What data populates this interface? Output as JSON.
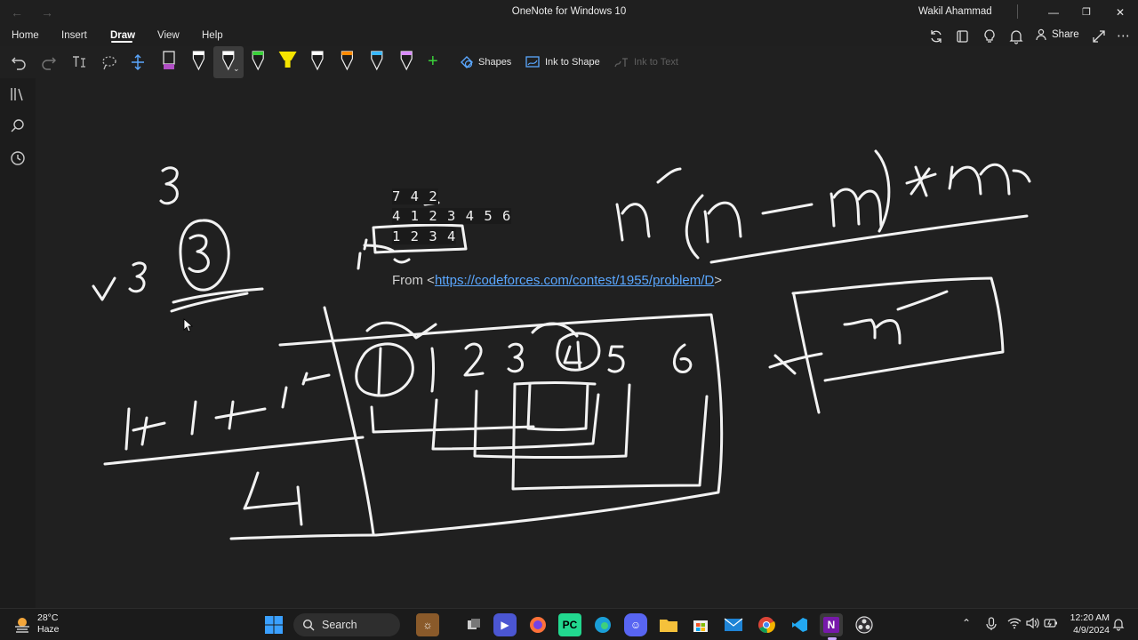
{
  "window": {
    "title": "OneNote for Windows 10",
    "user": "Wakil Ahammad",
    "back_glyph": "←",
    "forward_glyph": "→",
    "minimize_glyph": "—",
    "maximize_glyph": "❐",
    "close_glyph": "✕"
  },
  "menu": {
    "items": [
      "Home",
      "Insert",
      "Draw",
      "View",
      "Help"
    ],
    "active": "Draw",
    "share_label": "Share",
    "more_glyph": "⋯"
  },
  "toolbar": {
    "shapes_label": "Shapes",
    "ink_to_shape_label": "Ink to Shape",
    "ink_to_text_label": "Ink to Text",
    "add_pen_glyph": "+",
    "pens": [
      {
        "color": "#b14fc5",
        "kind": "marker"
      },
      {
        "color": "#ffffff",
        "kind": "pen"
      },
      {
        "color": "#ffffff",
        "kind": "pen",
        "selected": true
      },
      {
        "color": "#3ad13a",
        "kind": "pen"
      },
      {
        "color": "#f5e400",
        "kind": "highlighter"
      },
      {
        "color": "#ffffff",
        "kind": "pen"
      },
      {
        "color": "#ff8a00",
        "kind": "pen"
      },
      {
        "color": "#39b8ff",
        "kind": "pen"
      },
      {
        "color": "#d98cff",
        "kind": "pen"
      }
    ]
  },
  "note": {
    "typed_lines": [
      "7 4 2",
      "4 1 2 3 4 5 6",
      "1 2 3 4"
    ],
    "from_prefix": "From <",
    "from_link": "https://codeforces.com/contest/1955/problem/D",
    "from_suffix": ">"
  },
  "taskbar": {
    "temperature": "28°C",
    "weather": "Haze",
    "search_placeholder": "Search",
    "time": "12:20 AM",
    "date": "4/9/2024",
    "apps": [
      "Start",
      "Task View",
      "Zoom",
      "Firefox",
      "PyCharm",
      "Edge",
      "Discord",
      "File Explorer",
      "Microsoft Store",
      "Mail",
      "Chrome",
      "VS Code",
      "OneNote",
      "OBS"
    ]
  }
}
